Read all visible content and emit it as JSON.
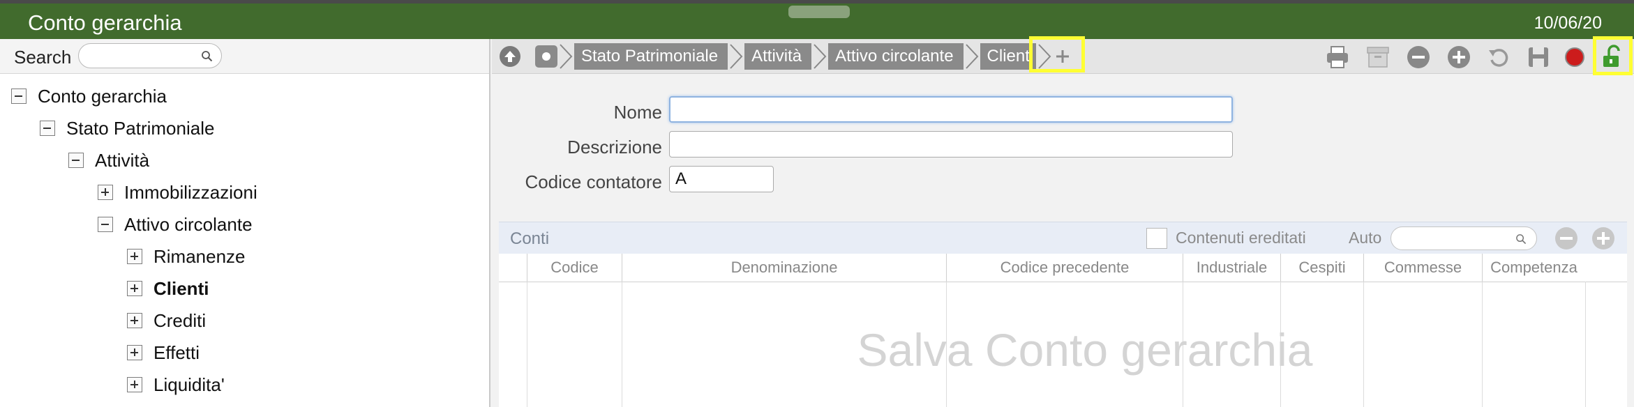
{
  "window": {
    "title": "Conto gerarchia",
    "date": "10/06/20"
  },
  "search": {
    "label": "Search",
    "value": "",
    "icon": "search-icon"
  },
  "tree": [
    {
      "label": "Conto gerarchia",
      "state": "expanded",
      "level": 0,
      "bold": false
    },
    {
      "label": "Stato Patrimoniale",
      "state": "expanded",
      "level": 1,
      "bold": false
    },
    {
      "label": "Attività",
      "state": "expanded",
      "level": 2,
      "bold": false
    },
    {
      "label": "Immobilizzazioni",
      "state": "collapsed",
      "level": 3,
      "bold": false
    },
    {
      "label": "Attivo circolante",
      "state": "expanded",
      "level": 3,
      "bold": false
    },
    {
      "label": "Rimanenze",
      "state": "collapsed",
      "level": 4,
      "bold": false
    },
    {
      "label": "Clienti",
      "state": "collapsed",
      "level": 4,
      "bold": true
    },
    {
      "label": "Crediti",
      "state": "collapsed",
      "level": 4,
      "bold": false
    },
    {
      "label": "Effetti",
      "state": "collapsed",
      "level": 4,
      "bold": false
    },
    {
      "label": "Liquidita'",
      "state": "collapsed",
      "level": 4,
      "bold": false
    }
  ],
  "breadcrumb": {
    "items": [
      "Stato Patrimoniale",
      "Attività",
      "Attivo circolante",
      "Clienti"
    ],
    "add_icon": "plus-icon"
  },
  "toolbar": {
    "icons": [
      "print-icon",
      "archive-icon",
      "minus-circle-icon",
      "plus-circle-icon",
      "undo-icon",
      "save-icon",
      "record-icon",
      "unlock-icon"
    ]
  },
  "form": {
    "nome": {
      "label": "Nome",
      "value": ""
    },
    "descrizione": {
      "label": "Descrizione",
      "value": ""
    },
    "codice_contatore": {
      "label": "Codice contatore",
      "value": "A"
    }
  },
  "grid": {
    "caption": "Conti",
    "inherited_label": "Contenuti ereditati",
    "auto_label": "Auto",
    "auto_value": "",
    "columns": [
      "Codice",
      "Denominazione",
      "Codice precedente",
      "Industriale",
      "Cespiti",
      "Commesse",
      "Competenza"
    ],
    "empty_message": "Salva Conto gerarchia"
  },
  "colors": {
    "titlebar": "#416b2d",
    "highlight": "#ffff33",
    "unlock": "#3f9b2e",
    "record": "#cc1c1c"
  }
}
